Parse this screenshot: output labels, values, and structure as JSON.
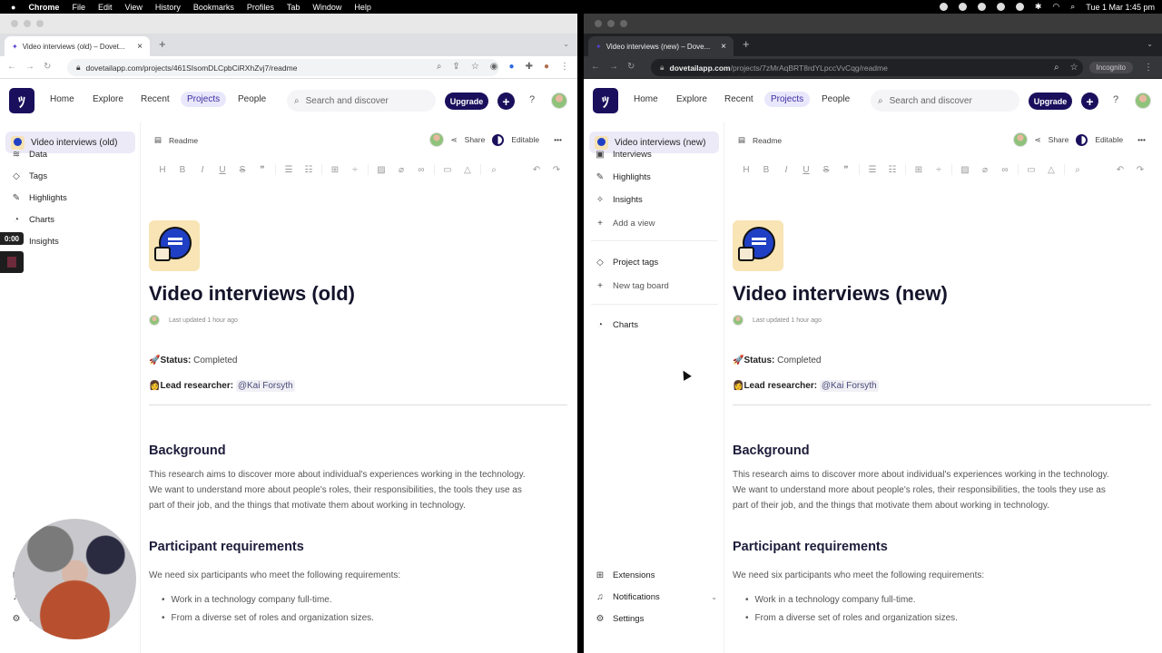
{
  "menubar": {
    "apple": "",
    "items": [
      "Chrome",
      "File",
      "Edit",
      "View",
      "History",
      "Bookmarks",
      "Profiles",
      "Tab",
      "Window",
      "Help"
    ],
    "clock": "Tue 1 Mar  1:45 pm"
  },
  "recording": {
    "timer": "0:00"
  },
  "left": {
    "tab_title": "Video interviews (old) – Dovet...",
    "url": "dovetailapp.com/projects/461SIsomDLCpbCiRXhZvj7/readme",
    "url_host": "",
    "incognito": "",
    "nav": {
      "home": "Home",
      "explore": "Explore",
      "recent": "Recent",
      "projects": "Projects",
      "people": "People",
      "search_placeholder": "Search and discover",
      "upgrade": "Upgrade",
      "help": "?"
    },
    "project_name": "Video interviews (old)",
    "sidebar_items": [
      {
        "label": "Data",
        "icon": "layers-icon",
        "glyph": "≋"
      },
      {
        "label": "Tags",
        "icon": "tag-icon",
        "glyph": "◇"
      },
      {
        "label": "Highlights",
        "icon": "highlighter-icon",
        "glyph": "✎"
      },
      {
        "label": "Charts",
        "icon": "chart-icon",
        "glyph": "◔"
      },
      {
        "label": "Insights",
        "icon": "insights-icon",
        "glyph": "✧"
      }
    ],
    "sidebar_bottom": [
      {
        "label": "Extensions",
        "icon": "extensions-icon",
        "glyph": "⊞"
      },
      {
        "label": "Notifications",
        "icon": "bell-icon",
        "glyph": "♫"
      },
      {
        "label": "Settings",
        "icon": "gear-icon",
        "glyph": "⚙"
      }
    ],
    "doc": {
      "breadcrumb": "Readme",
      "share": "Share",
      "editable": "Editable",
      "title": "Video interviews (old)",
      "updated": "Last updated 1 hour ago",
      "status_label": "🚀Status:",
      "status_value": "Completed",
      "lead_label": "👩Lead researcher:",
      "lead_value": "@Kai Forsyth",
      "background_heading": "Background",
      "background_lines": [
        "This research aims to discover more about individual's experiences working in the technology.",
        "We want to understand more about people's roles, their responsibilities, the tools they use as",
        "part of their job, and the things that motivate them about working in technology."
      ],
      "req_heading": "Participant requirements",
      "req_intro": "We need six participants who meet the following requirements:",
      "req_bullets": [
        "Work in a technology company full-time.",
        "From a diverse set of roles and organization sizes."
      ]
    }
  },
  "right": {
    "tab_title": "Video interviews (new) – Dove...",
    "url": "/projects/7zMrAqBRT8rdYLpccVvCqg/readme",
    "url_host": "dovetailapp.com",
    "incognito": "Incognito",
    "nav": {
      "home": "Home",
      "explore": "Explore",
      "recent": "Recent",
      "projects": "Projects",
      "people": "People",
      "search_placeholder": "Search and discover",
      "upgrade": "Upgrade",
      "help": "?"
    },
    "project_name": "Video interviews (new)",
    "sidebar_items": [
      {
        "label": "Interviews",
        "icon": "video-icon",
        "glyph": "▣"
      },
      {
        "label": "Highlights",
        "icon": "highlighter-icon",
        "glyph": "✎"
      },
      {
        "label": "Insights",
        "icon": "insights-icon",
        "glyph": "✧"
      },
      {
        "label": "Add a view",
        "icon": "plus-icon",
        "glyph": "+"
      },
      {
        "label": "Project tags",
        "icon": "tag-icon",
        "glyph": "◇"
      },
      {
        "label": "New tag board",
        "icon": "plus-icon",
        "glyph": "+"
      },
      {
        "label": "Charts",
        "icon": "chart-icon",
        "glyph": "◔"
      }
    ],
    "sidebar_bottom": [
      {
        "label": "Extensions",
        "icon": "extensions-icon",
        "glyph": "⊞"
      },
      {
        "label": "Notifications",
        "icon": "bell-icon",
        "glyph": "♫"
      },
      {
        "label": "Settings",
        "icon": "gear-icon",
        "glyph": "⚙"
      }
    ],
    "doc": {
      "breadcrumb": "Readme",
      "share": "Share",
      "editable": "Editable",
      "title": "Video interviews (new)",
      "updated": "Last updated 1 hour ago",
      "status_label": "🚀Status:",
      "status_value": "Completed",
      "lead_label": "👩Lead researcher:",
      "lead_value": "@Kai Forsyth",
      "background_heading": "Background",
      "background_lines": [
        "This research aims to discover more about individual's experiences working in the technology.",
        "We want to understand more about people's roles, their responsibilities, the tools they use as",
        "part of their job, and the things that motivate them about working in technology."
      ],
      "req_heading": "Participant requirements",
      "req_intro": "We need six participants who meet the following requirements:",
      "req_bullets": [
        "Work in a technology company full-time.",
        "From a diverse set of roles and organization sizes."
      ]
    }
  }
}
